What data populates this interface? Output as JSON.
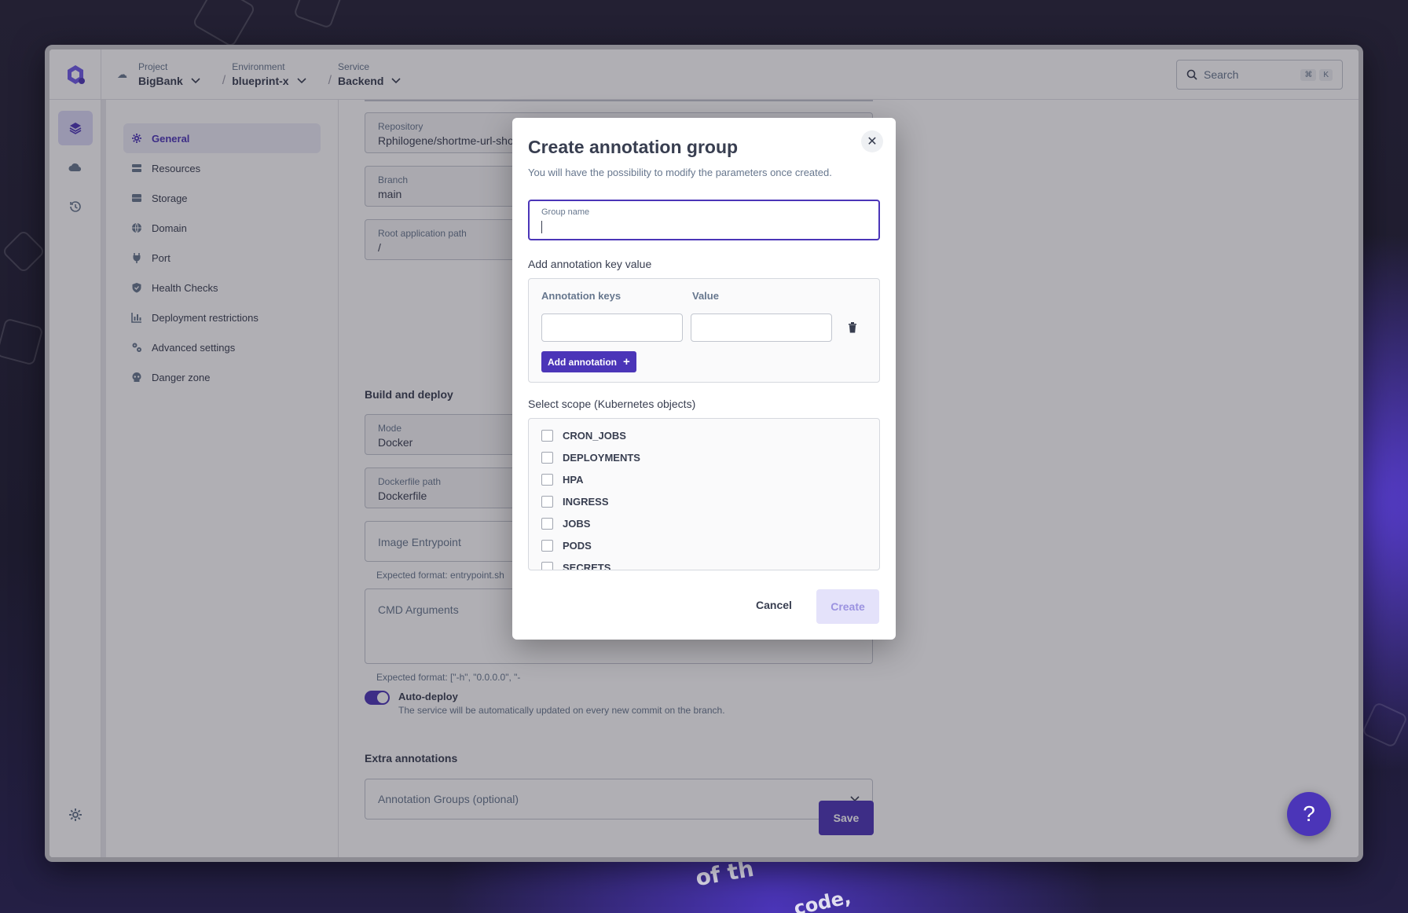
{
  "topbar": {
    "project": {
      "label": "Project",
      "value": "BigBank"
    },
    "environment": {
      "label": "Environment",
      "value": "blueprint-x"
    },
    "service": {
      "label": "Service",
      "value": "Backend"
    },
    "separator": "/",
    "search_placeholder": "Search",
    "shortcut": [
      "⌘",
      "K"
    ]
  },
  "nav": {
    "items": [
      "General",
      "Resources",
      "Storage",
      "Domain",
      "Port",
      "Health Checks",
      "Deployment restrictions",
      "Advanced settings",
      "Danger zone"
    ],
    "active": "General"
  },
  "form": {
    "repository": {
      "label": "Repository",
      "value": "Rphilogene/shortme-url-shor"
    },
    "branch": {
      "label": "Branch",
      "value": "main"
    },
    "root_path": {
      "label": "Root application path",
      "value": "/"
    },
    "build_section": "Build and deploy",
    "mode": {
      "label": "Mode",
      "value": "Docker"
    },
    "dockerfile": {
      "label": "Dockerfile path",
      "value": "Dockerfile"
    },
    "entrypoint": {
      "placeholder": "Image Entrypoint",
      "hint": "Expected format: entrypoint.sh"
    },
    "cmd": {
      "placeholder": "CMD Arguments",
      "hint": "Expected format: [\"-h\", \"0.0.0.0\", \"-"
    },
    "autodeploy": {
      "title": "Auto-deploy",
      "description": "The service will be automatically updated on every new commit on the branch.",
      "enabled": true
    },
    "extra_section": "Extra annotations",
    "annotation_groups_placeholder": "Annotation Groups (optional)",
    "save_label": "Save"
  },
  "modal": {
    "title": "Create annotation group",
    "subtitle": "You will have the possibility to modify the parameters once created.",
    "close": "✕",
    "group_name_label": "Group name",
    "kv_section": "Add annotation key value",
    "col_keys": "Annotation keys",
    "col_value": "Value",
    "add_annotation": "Add annotation",
    "add_icon": "+",
    "scope_section": "Select scope (Kubernetes objects)",
    "scopes": [
      "CRON_JOBS",
      "DEPLOYMENTS",
      "HPA",
      "INGRESS",
      "JOBS",
      "PODS",
      "SECRETS"
    ],
    "cancel": "Cancel",
    "create": "Create"
  },
  "help_label": "?",
  "colors": {
    "brand": "#4b35b8",
    "text": "#383e50",
    "muted": "#67778e"
  }
}
